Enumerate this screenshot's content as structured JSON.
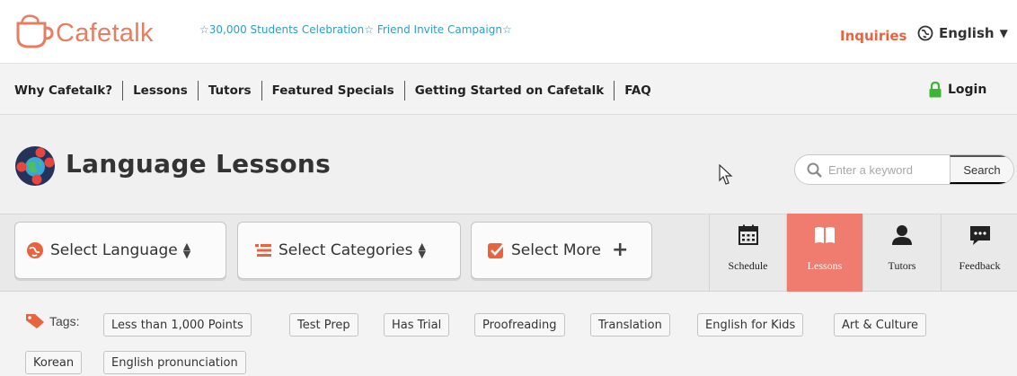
{
  "header": {
    "logo_text": "Cafetalk",
    "campaign": "☆30,000 Students Celebration☆ Friend Invite Campaign☆",
    "inquiries": "Inquiries",
    "language": "English",
    "language_caret": "▼",
    "accent_color": "#e8643f"
  },
  "nav": {
    "items": [
      {
        "label": "Why Cafetalk?"
      },
      {
        "label": "Lessons"
      },
      {
        "label": "Tutors"
      },
      {
        "label": "Featured Specials"
      },
      {
        "label": "Getting Started on Cafetalk"
      },
      {
        "label": "FAQ"
      }
    ],
    "login": "Login",
    "login_icon_color": "#3db634"
  },
  "page": {
    "title": "Language Lessons",
    "search_placeholder": "Enter a keyword",
    "search_button": "Search"
  },
  "filters": {
    "language": "Select Language",
    "categories": "Select Categories",
    "more": "Select More",
    "sort_icon_up": "▲",
    "sort_icon_down": "▼",
    "more_icon": "+"
  },
  "view_tabs": [
    {
      "label": "Schedule",
      "icon": "calendar-icon",
      "active": false
    },
    {
      "label": "Lessons",
      "icon": "book-icon",
      "active": true
    },
    {
      "label": "Tutors",
      "icon": "person-icon",
      "active": false
    },
    {
      "label": "Feedback",
      "icon": "speech-bubble-icon",
      "active": false
    }
  ],
  "tags": {
    "label": "Tags:",
    "items": [
      "Less than 1,000 Points",
      "Test Prep",
      "Has Trial",
      "Proofreading",
      "Translation",
      "English for Kids",
      "Art & Culture",
      "Korean",
      "English pronunciation"
    ]
  }
}
